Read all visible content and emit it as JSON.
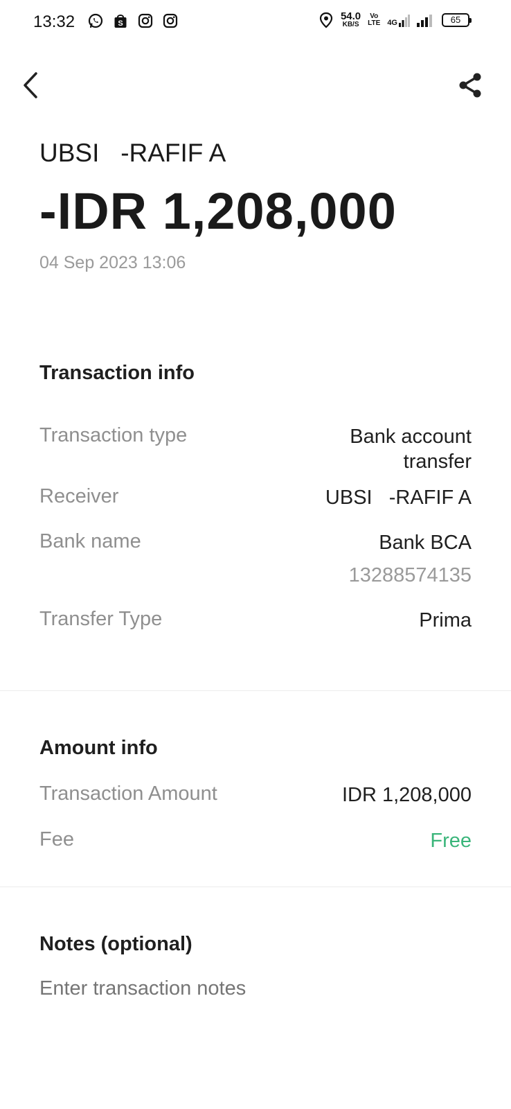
{
  "status_bar": {
    "time": "13:32",
    "net_speed_value": "54.0",
    "net_speed_unit": "KB/S",
    "volte_top": "Vo",
    "volte_bottom": "LTE",
    "network_type": "4G",
    "battery": "65",
    "left_icons": [
      "whatsapp-icon",
      "shopee-icon",
      "instagram-icon",
      "instagram-icon"
    ],
    "right_icons": [
      "location-icon",
      "signal-icon",
      "battery-icon"
    ]
  },
  "nav": {
    "back_icon": "chevron-left-icon",
    "share_icon": "share-icon"
  },
  "header": {
    "receiver_title": "UBSI   -RAFIF A",
    "amount": "-IDR 1,208,000",
    "datetime": "04 Sep 2023 13:06"
  },
  "transaction_info": {
    "title": "Transaction info",
    "type_label": "Transaction type",
    "type_value": "Bank account\ntransfer",
    "receiver_label": "Receiver",
    "receiver_value": "UBSI   -RAFIF A",
    "bank_label": "Bank name",
    "bank_value": "Bank BCA",
    "account_number": "13288574135",
    "transfer_type_label": "Transfer Type",
    "transfer_type_value": "Prima"
  },
  "amount_info": {
    "title": "Amount info",
    "amount_label": "Transaction Amount",
    "amount_value": "IDR 1,208,000",
    "fee_label": "Fee",
    "fee_value": "Free"
  },
  "notes": {
    "title": "Notes (optional)",
    "placeholder": "Enter transaction notes"
  },
  "colors": {
    "accent_green": "#3ab57a",
    "text_primary": "#1f1f1f",
    "text_secondary": "#8f8f8f"
  }
}
